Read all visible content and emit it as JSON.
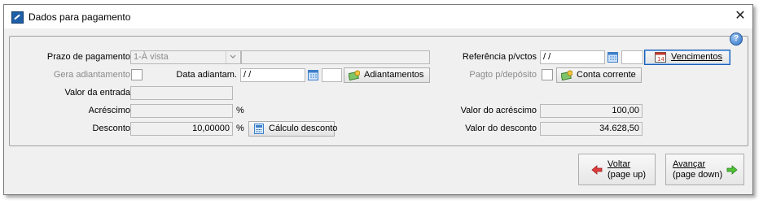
{
  "window": {
    "title": "Dados para pagamento",
    "close_glyph": "✕",
    "help_glyph": "?"
  },
  "form": {
    "prazo_label": "Prazo de pagamento",
    "prazo_value": "1-À vista",
    "prazo_extra": "",
    "gera_label": "Gera adiantamento",
    "data_adiant_label": "Data adiantam.",
    "data_adiant_value": " /  /",
    "adiantamentos_button": "Adiantamentos",
    "valor_entrada_label": "Valor da entrada",
    "valor_entrada_value": "",
    "acrescimo_label": "Acréscimo",
    "acrescimo_value": "",
    "percent": "%",
    "desconto_label": "Desconto",
    "desconto_value": "10,00000",
    "calculo_button": "Cálculo desconto",
    "referencia_label": "Referência p/vctos",
    "referencia_value": " /  /",
    "vencimentos_button": "Vencimentos",
    "pagto_label": "Pagto p/depósito",
    "conta_button": "Conta corrente",
    "valor_acrescimo_label": "Valor do acréscimo",
    "valor_acrescimo_value": "100,00",
    "valor_desconto_label": "Valor do desconto",
    "valor_desconto_value": "34.628,50"
  },
  "footer": {
    "voltar_line1": "Voltar",
    "voltar_line2": "(page up)",
    "avancar_line1": "Avançar",
    "avancar_line2": "(page down)"
  }
}
